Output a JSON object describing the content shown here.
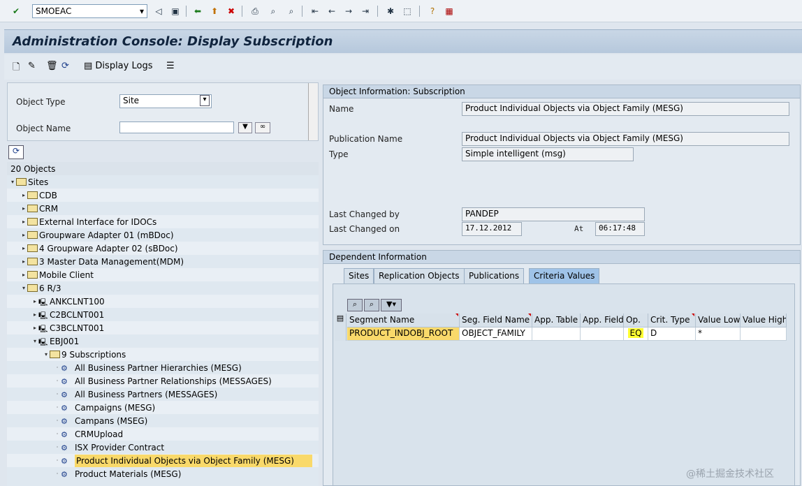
{
  "toolbar": {
    "command_field": "SMOEAC",
    "icons": [
      "check-icon",
      "back-icon",
      "save-icon",
      "back-nav-icon",
      "exit-icon",
      "cancel-icon",
      "print-icon",
      "find-icon",
      "find-next-icon",
      "first-page-icon",
      "prev-page-icon",
      "next-page-icon",
      "last-page-icon",
      "new-session-icon",
      "shortcut-icon",
      "help-icon",
      "layout-icon"
    ]
  },
  "title": "Administration Console: Display Subscription",
  "app_toolbar": {
    "display_logs": "Display Logs"
  },
  "selection": {
    "object_type_label": "Object Type",
    "object_type_value": "Site",
    "object_name_label": "Object Name",
    "object_name_value": ""
  },
  "tree": {
    "count": "20 Objects",
    "items": [
      {
        "label": "Sites"
      },
      {
        "label": "CDB"
      },
      {
        "label": "CRM"
      },
      {
        "label": "External Interface for IDOCs"
      },
      {
        "label": "Groupware Adapter 01 (mBDoc)"
      },
      {
        "label": "4 Groupware Adapter 02 (sBDoc)"
      },
      {
        "label": "3 Master Data Management(MDM)"
      },
      {
        "label": "Mobile Client"
      },
      {
        "label": "6 R/3"
      },
      {
        "label": "ANKCLNT100"
      },
      {
        "label": "C2BCLNT001"
      },
      {
        "label": "C3BCLNT001"
      },
      {
        "label": "EBJ001"
      },
      {
        "label": "9 Subscriptions"
      },
      {
        "label": "All Business Partner Hierarchies (MESG)"
      },
      {
        "label": "All Business Partner Relationships (MESSAGES)"
      },
      {
        "label": "All Business Partners (MESSAGES)"
      },
      {
        "label": "Campaigns (MESG)"
      },
      {
        "label": "Campans (MSEG)"
      },
      {
        "label": "CRMUpload"
      },
      {
        "label": "ISX Provider Contract"
      },
      {
        "label": "Product Individual Objects via Object Family (MESG)"
      },
      {
        "label": "Product Materials (MESG)"
      }
    ]
  },
  "object_info": {
    "header": "Object Information: Subscription",
    "name_label": "Name",
    "name_value": "Product Individual Objects via Object Family (MESG)",
    "pub_label": "Publication Name",
    "pub_value": "Product Individual Objects via Object Family (MESG)",
    "type_label": "Type",
    "type_value": "Simple intelligent (msg)",
    "changed_by_label": "Last Changed by",
    "changed_by_value": "PANDEP",
    "changed_on_label": "Last Changed on",
    "changed_on_value": "17.12.2012",
    "at_label": "At",
    "at_value": "06:17:48"
  },
  "dependent": {
    "header": "Dependent Information",
    "tabs": [
      "Sites",
      "Replication Objects",
      "Publications",
      "Criteria Values"
    ],
    "active_tab": "Criteria Values",
    "columns": [
      "Segment Name",
      "Seg. Field Name",
      "App. Table",
      "App. Field",
      "Op.",
      "Crit. Type",
      "Value Low",
      "Value High"
    ],
    "rows": [
      [
        "PRODUCT_INDOBJ_ROOT",
        "OBJECT_FAMILY",
        "",
        "",
        "EQ",
        "D",
        "*",
        ""
      ]
    ]
  },
  "watermark": "@稀土掘金技术社区",
  "colors": {
    "selected": "#f9d96a",
    "title": "#10243e",
    "active_tab": "#9fc3e8"
  }
}
